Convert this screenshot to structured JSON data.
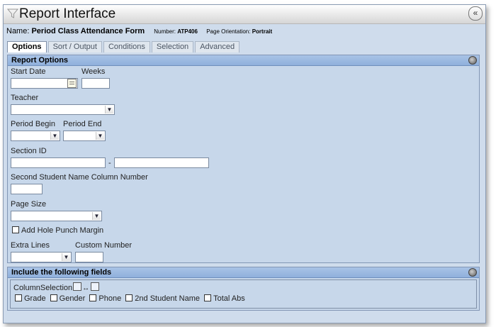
{
  "window": {
    "title": "Report Interface",
    "collapse_label": "«"
  },
  "report": {
    "name_label": "Name:",
    "name_value": "Period Class Attendance Form",
    "number_label": "Number:",
    "number_value": "ATP406",
    "orientation_label": "Page Orientation:",
    "orientation_value": "Portrait"
  },
  "tabs": [
    {
      "label": "Options"
    },
    {
      "label": "Sort / Output"
    },
    {
      "label": "Conditions"
    },
    {
      "label": "Selection"
    },
    {
      "label": "Advanced"
    }
  ],
  "report_options": {
    "title": "Report Options",
    "start_date_label": "Start Date",
    "weeks_label": "Weeks",
    "teacher_label": "Teacher",
    "period_begin_label": "Period Begin",
    "period_end_label": "Period End",
    "section_id_label": "Section ID",
    "section_dash": "-",
    "second_student_label": "Second Student Name Column Number",
    "page_size_label": "Page Size",
    "hole_punch_label": "Add Hole Punch Margin",
    "extra_lines_label": "Extra Lines",
    "custom_number_label": "Custom Number"
  },
  "include_fields": {
    "title": "Include the following fields",
    "column_selection_label": "ColumnSelection",
    "arrows": "↔",
    "fields": [
      "Grade",
      "Gender",
      "Phone",
      "2nd Student Name",
      "Total Abs"
    ]
  },
  "icons": {
    "title": "funnel-icon",
    "calendar": "calendar-icon",
    "toggle": "collapse-circle-icon"
  }
}
